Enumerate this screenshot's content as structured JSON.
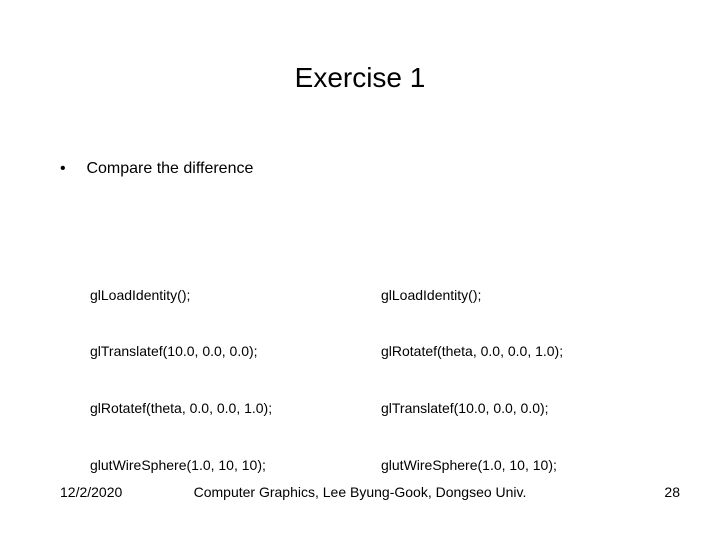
{
  "title": "Exercise 1",
  "subtitle": "Compare the difference",
  "bullet_glyph": "•",
  "code_left": {
    "line1": "glLoadIdentity();",
    "line2": "glTranslatef(10.0, 0.0, 0.0);",
    "line3": "glRotatef(theta, 0.0, 0.0, 1.0);",
    "line4": "glutWireSphere(1.0, 10, 10);"
  },
  "code_right": {
    "line1": "glLoadIdentity();",
    "line2": "glRotatef(theta, 0.0, 0.0, 1.0);",
    "line3": "glTranslatef(10.0, 0.0, 0.0);",
    "line4": "glutWireSphere(1.0, 10, 10);"
  },
  "footer": {
    "date": "12/2/2020",
    "center": "Computer Graphics, Lee Byung-Gook, Dongseo Univ.",
    "page": "28"
  }
}
